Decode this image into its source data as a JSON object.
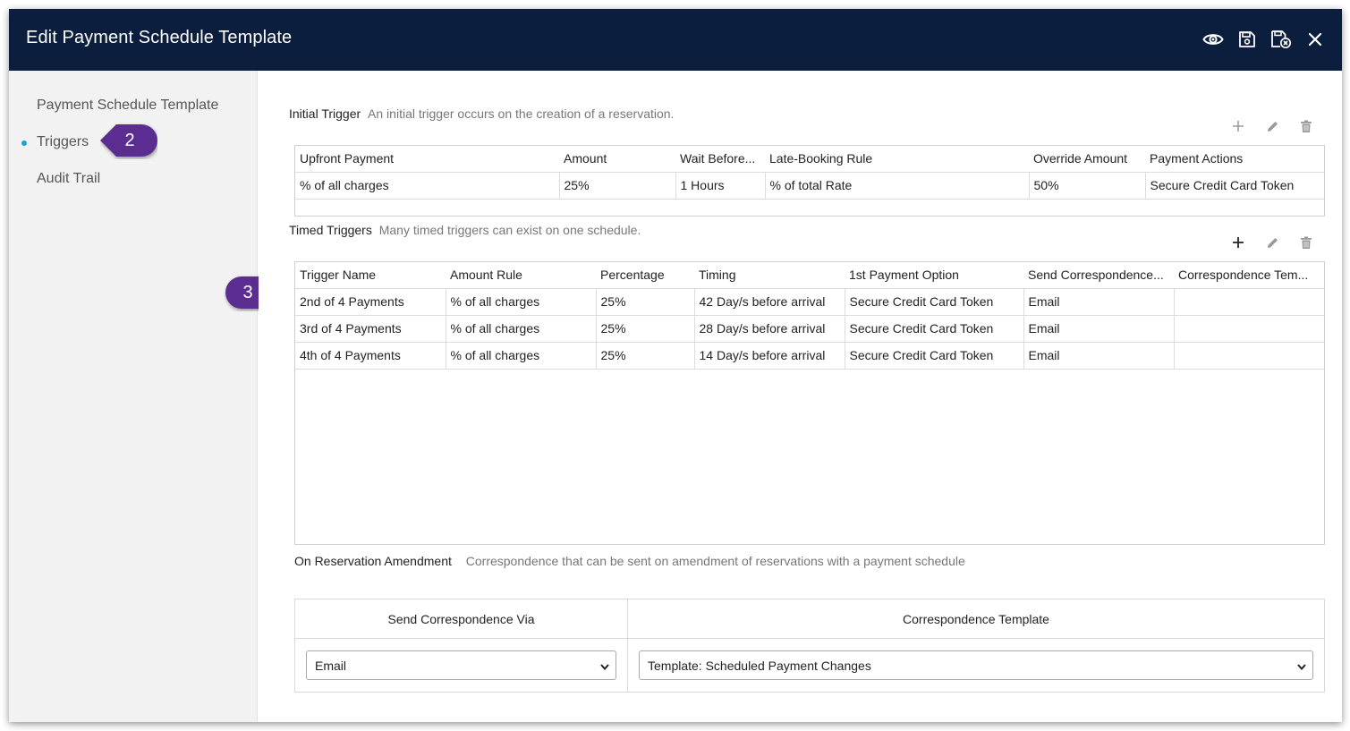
{
  "window": {
    "title": "Edit Payment Schedule Template",
    "icons": [
      "eye-icon",
      "save-icon",
      "save-close-icon",
      "close-icon"
    ]
  },
  "sidebar": {
    "items": [
      {
        "label": "Payment Schedule Template",
        "active": false
      },
      {
        "label": "Triggers",
        "active": true
      },
      {
        "label": "Audit Trail",
        "active": false
      }
    ]
  },
  "callouts": [
    "2",
    "3"
  ],
  "initial_trigger": {
    "heading": "Initial Trigger",
    "description": "An initial trigger occurs on the creation of a reservation.",
    "columns": [
      "Upfront Payment",
      "Amount",
      "Wait Before...",
      "Late-Booking Rule",
      "Override Amount",
      "Payment Actions"
    ],
    "rows": [
      [
        "% of all charges",
        "25%",
        "1 Hours",
        "% of total Rate",
        "50%",
        "Secure Credit Card Token"
      ]
    ]
  },
  "timed_triggers": {
    "heading": "Timed Triggers",
    "description": "Many timed triggers can exist on one schedule.",
    "columns": [
      "Trigger Name",
      "Amount Rule",
      "Percentage",
      "Timing",
      "1st Payment Option",
      "Send Correspondence...",
      "Correspondence Tem..."
    ],
    "rows": [
      [
        "2nd of 4 Payments",
        "% of all charges",
        "25%",
        "42 Day/s before arrival",
        "Secure Credit Card Token",
        "Email",
        ""
      ],
      [
        "3rd of 4 Payments",
        "% of all charges",
        "25%",
        "28 Day/s before arrival",
        "Secure Credit Card Token",
        "Email",
        ""
      ],
      [
        "4th of 4 Payments",
        "% of all charges",
        "25%",
        "14 Day/s before arrival",
        "Secure Credit Card Token",
        "Email",
        ""
      ]
    ]
  },
  "amendment": {
    "heading": "On Reservation Amendment",
    "description": "Correspondence that can be sent on amendment of reservations with a payment schedule",
    "send_via_header": "Send Correspondence Via",
    "template_header": "Correspondence Template",
    "send_via_value": "Email",
    "template_value": "Template: Scheduled Payment Changes"
  },
  "colors": {
    "titlebar": "#0b1e3d",
    "callout": "#5b2d90",
    "active_dot": "#1aa3d9"
  }
}
